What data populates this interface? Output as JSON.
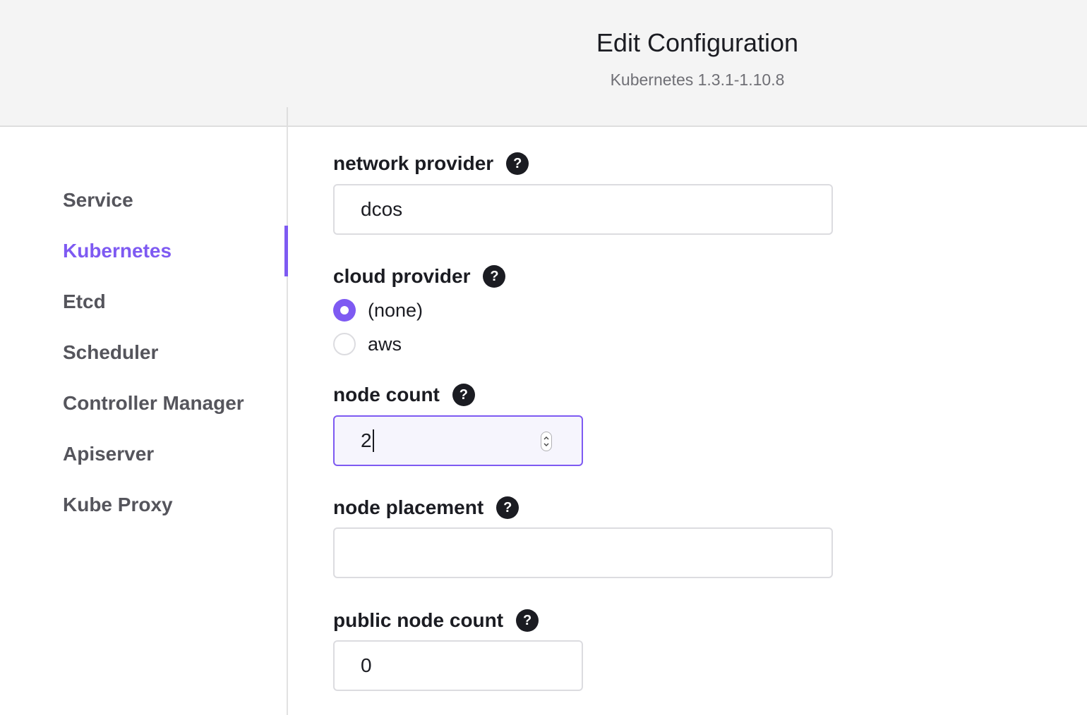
{
  "header": {
    "title": "Edit Configuration",
    "subtitle": "Kubernetes 1.3.1-1.10.8"
  },
  "sidebar": {
    "items": [
      {
        "label": "Service"
      },
      {
        "label": "Kubernetes",
        "active": true
      },
      {
        "label": "Etcd"
      },
      {
        "label": "Scheduler"
      },
      {
        "label": "Controller Manager"
      },
      {
        "label": "Apiserver"
      },
      {
        "label": "Kube Proxy"
      }
    ]
  },
  "form": {
    "network_provider": {
      "label": "network provider",
      "help": "?",
      "value": "dcos"
    },
    "cloud_provider": {
      "label": "cloud provider",
      "help": "?",
      "options": [
        {
          "label": "(none)",
          "checked": true
        },
        {
          "label": "aws",
          "checked": false
        }
      ]
    },
    "node_count": {
      "label": "node count",
      "help": "?",
      "value": "2"
    },
    "node_placement": {
      "label": "node placement",
      "help": "?",
      "value": ""
    },
    "public_node_count": {
      "label": "public node count",
      "help": "?",
      "value": "0"
    }
  },
  "colors": {
    "accent": "#7e5af2",
    "header_bg": "#f4f4f4",
    "text": "#1b1c22",
    "muted_text": "#55555c"
  }
}
